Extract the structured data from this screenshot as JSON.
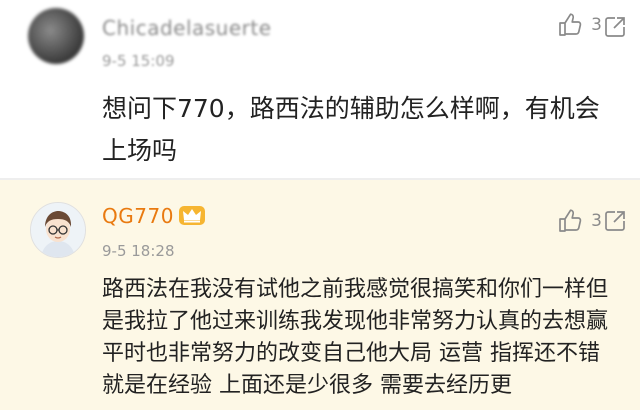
{
  "comments": [
    {
      "username": "Chicadelasuerte",
      "time": "9-5 15:09",
      "like_count": "3",
      "text": "想问下770，路西法的辅助怎么样啊，有机会上场吗"
    },
    {
      "username": "QG770",
      "time": "9-5 18:28",
      "like_count": "3",
      "text": "路西法在我没有试他之前我感觉很搞笑和你们一样但是我拉了他过来训练我发现他非常努力认真的去想赢 平时也非常努力的改变自己他大局 运营 指挥还不错 就是在经验 上面还是少很多 需要去经历更"
    }
  ],
  "icons": {
    "like": "thumbs-up-icon",
    "more": "share-box-icon",
    "badge": "crown-vip-icon"
  },
  "colors": {
    "author_name": "#e97a10",
    "highlight_bg": "#fdf8e6"
  }
}
